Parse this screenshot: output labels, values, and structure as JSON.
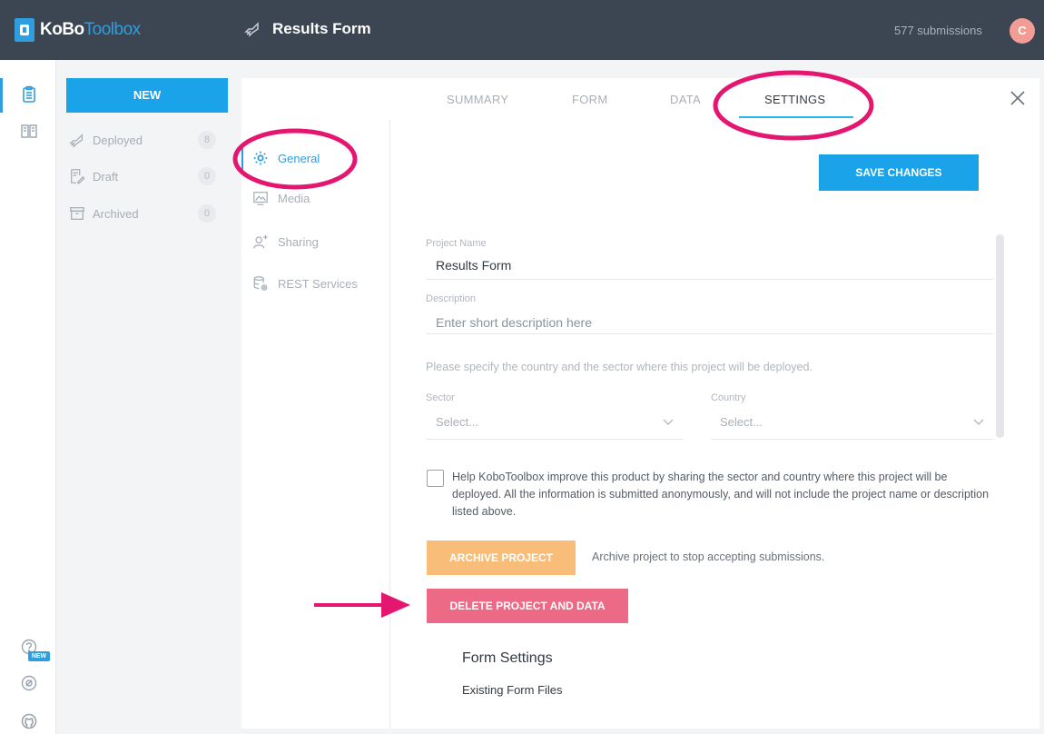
{
  "header": {
    "logo_part1": "KoBo",
    "logo_part2": "Toolbox",
    "form_title": "Results Form",
    "submissions": "577 submissions",
    "avatar_initial": "C",
    "brand_color": "#2e9ee0"
  },
  "sidebar": {
    "new_label": "NEW",
    "items": [
      {
        "label": "Deployed",
        "count": "8",
        "icon": "rocket-icon"
      },
      {
        "label": "Draft",
        "count": "0",
        "icon": "draft-icon"
      },
      {
        "label": "Archived",
        "count": "0",
        "icon": "archive-icon"
      }
    ]
  },
  "rail": {
    "help_badge": "NEW",
    "icons": [
      "forms-icon",
      "library-icon",
      "help-icon",
      "support-icon",
      "github-icon"
    ]
  },
  "tabs": [
    {
      "label": "SUMMARY",
      "active": false
    },
    {
      "label": "FORM",
      "active": false
    },
    {
      "label": "DATA",
      "active": false
    },
    {
      "label": "SETTINGS",
      "active": true
    }
  ],
  "settings_nav": [
    {
      "label": "General",
      "active": true,
      "icon": "gear-icon"
    },
    {
      "label": "Media",
      "active": false,
      "icon": "media-icon"
    },
    {
      "label": "Sharing",
      "active": false,
      "icon": "add-user-icon"
    },
    {
      "label": "REST Services",
      "active": false,
      "icon": "rest-services-icon"
    }
  ],
  "form": {
    "save_label": "SAVE CHANGES",
    "project_name_label": "Project Name",
    "project_name_value": "Results Form",
    "description_label": "Description",
    "description_placeholder": "Enter short description here",
    "country_sector_hint": "Please specify the country and the sector where this project will be deployed.",
    "sector_label": "Sector",
    "sector_value": "Select...",
    "country_label": "Country",
    "country_value": "Select...",
    "share_checkbox_checked": false,
    "share_text": "Help KoboToolbox improve this product by sharing the sector and country where this project will be deployed. All the information is submitted anonymously, and will not include the project name or description listed above.",
    "archive_label": "ARCHIVE PROJECT",
    "archive_hint": "Archive project to stop accepting submissions.",
    "delete_label": "DELETE PROJECT AND DATA",
    "form_settings_title": "Form Settings",
    "existing_files_label": "Existing Form Files"
  },
  "annotation_color": "#e5166f"
}
